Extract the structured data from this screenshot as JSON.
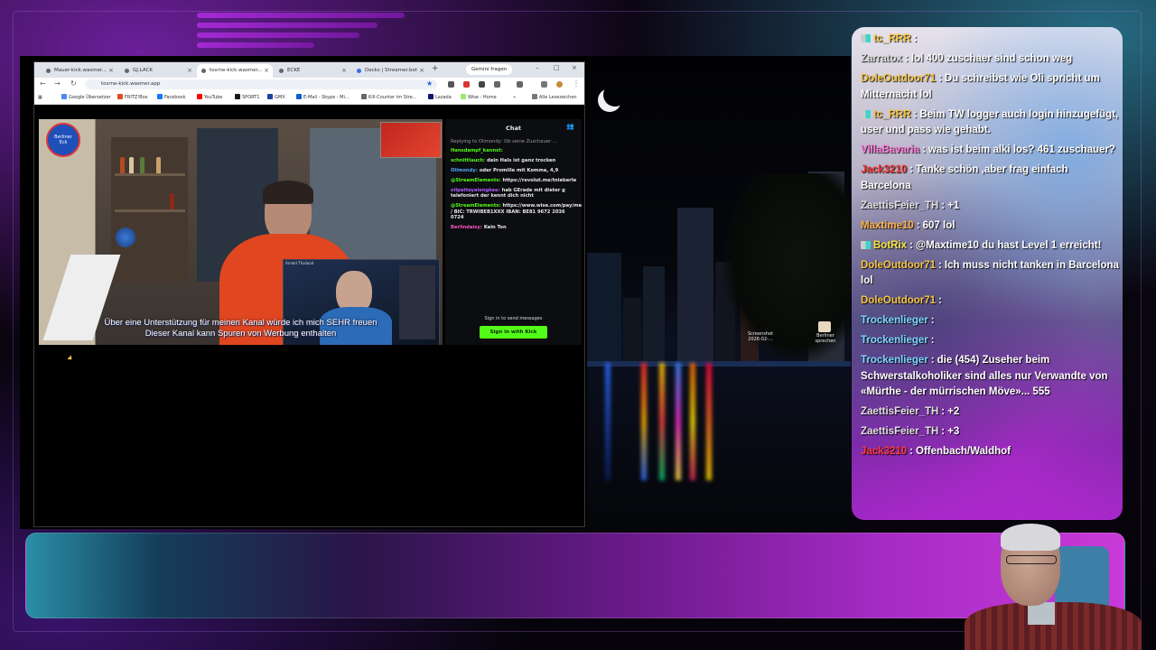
{
  "browser": {
    "tabs": [
      {
        "label": "Mauer-kick.wasmer..."
      },
      {
        "label": "GJ.LACK"
      },
      {
        "label": "tosrne-kick.wasmer..."
      },
      {
        "label": "ECKE"
      },
      {
        "label": "Decks | Streamer.bot"
      }
    ],
    "new_tab": "+",
    "gemini_label": "Gemini fragen",
    "url": "tosrne-kick.wasmer.app",
    "bookmarks": [
      "Google Übersetzer",
      "FRITZ!Box",
      "Facebook",
      "YouTube",
      "SPORT1",
      "GMX",
      "E-Mail - Skype - Mi...",
      "Kill-Counter im Stre...",
      "Lazada",
      "Wise - Home"
    ],
    "bookmarks_more": "»",
    "all_bookmarks": "Alle Lesezeichen"
  },
  "video": {
    "badge_line1": "Berliner",
    "badge_line2": "Eck",
    "pip_label": "Arnold Thailand",
    "subtitle_1": "Über eine Unterstützung für meinen Kanal würde ich mich SEHR freuen",
    "subtitle_2": "Dieser Kanal kann Spuren von Werbung enthalten"
  },
  "stream_chat": {
    "title": "Chat",
    "messages": [
      {
        "user": "Replying to Olimondy:",
        "text": "Ob seine Zuschauer ...",
        "color": "#9a9a9a"
      },
      {
        "user": "Hansdampf_kannst:",
        "text": "",
        "color": "#53fc18"
      },
      {
        "user": "schnittlauch:",
        "text": "dein Hals ist ganz trocken",
        "color": "#53fc18"
      },
      {
        "user": "Olimondy:",
        "text": "oder Promille mit Komma, 4,9",
        "color": "#53a7fc"
      },
      {
        "user": "@StreamElements:",
        "text": "https://revolut.me/tnieberle",
        "color": "#53fc18"
      },
      {
        "user": "oilpattayalengkee:",
        "text": "hab GErade mit dieter g telefoniert der kennt dich nicht",
        "color": "#b05bff"
      },
      {
        "user": "@StreamElements:",
        "text": "https://www.wise.com/pay/me/thomasn1229 / BIC: TRWIBEB1XXX IBAN: BE81 9672 2036 0724",
        "color": "#53fc18"
      },
      {
        "user": "Berlindaisy:",
        "text": "Kein Ton",
        "color": "#fc53c0"
      }
    ],
    "signin_note": "Sign in to send messages",
    "signin_button": "Sign in with Kick"
  },
  "desktop": {
    "icon1": "Screenshot 2026-02-...",
    "icon2": "Berliner sprechen"
  },
  "overlay_chat": [
    {
      "user": "tc_RRR",
      "sep": ":",
      "text": "",
      "color": "#f5c542",
      "badge": true
    },
    {
      "user": "Zarratox",
      "sep": ":",
      "text": "lol 400 zuschaer sind schon weg",
      "color": "#dcdcdc",
      "badge": false
    },
    {
      "user": "DoleOutdoor71",
      "sep": ":",
      "text": "Du schreibst wie Oli spricht um Mitternacht lol",
      "color": "#f5c542",
      "badge": false
    },
    {
      "user": "tc_RRR",
      "sep": ":",
      "text": "Beim TW logger auch login hinzugefügt, user und pass wie gehabt.",
      "color": "#f5c542",
      "badge": true
    },
    {
      "user": "VillaBavaria",
      "sep": ":",
      "text": "was ist beim alki los? 461 zuschauer?",
      "color": "#ff7ad9",
      "badge": false
    },
    {
      "user": "Jack3210",
      "sep": ":",
      "text": "Tanke schön ,aber frag einfach Barcelona",
      "color": "#ff3b3b",
      "badge": false
    },
    {
      "user": "ZaettisFeier_TH",
      "sep": ":",
      "text": "+1",
      "color": "#e0e0e0",
      "badge": false
    },
    {
      "user": "Maxtime10",
      "sep": ":",
      "text": "607 lol",
      "color": "#ffb347",
      "badge": false
    },
    {
      "user": "BotRix",
      "sep": ":",
      "text": "@Maxtime10 du hast Level 1 erreicht!",
      "color": "#f5e642",
      "badge": true
    },
    {
      "user": "DoleOutdoor71",
      "sep": ":",
      "text": "Ich muss nicht tanken in Barcelona lol",
      "color": "#f5c542",
      "badge": false
    },
    {
      "user": "DoleOutdoor71",
      "sep": ":",
      "text": "",
      "color": "#f5c542",
      "badge": false
    },
    {
      "user": "Trockenlieger",
      "sep": ":",
      "text": "",
      "color": "#7ad8ff",
      "badge": false
    },
    {
      "user": "Trockenlieger",
      "sep": ":",
      "text": "",
      "color": "#7ad8ff",
      "badge": false
    },
    {
      "user": "Trockenlieger",
      "sep": ":",
      "text": "die (454) Zuseher beim Schwerstalkoholiker sind alles nur Verwandte von «Mürthe - der mürrischen Möve»...  555",
      "color": "#7ad8ff",
      "badge": false
    },
    {
      "user": "ZaettisFeier_TH",
      "sep": ":",
      "text": "+2",
      "color": "#e0e0e0",
      "badge": false
    },
    {
      "user": "ZaettisFeier_TH",
      "sep": ":",
      "text": "+3",
      "color": "#e0e0e0",
      "badge": false
    },
    {
      "user": "Jack3210",
      "sep": ":",
      "text": "Offenbach/Waldhof",
      "color": "#ff3b3b",
      "badge": false
    }
  ]
}
